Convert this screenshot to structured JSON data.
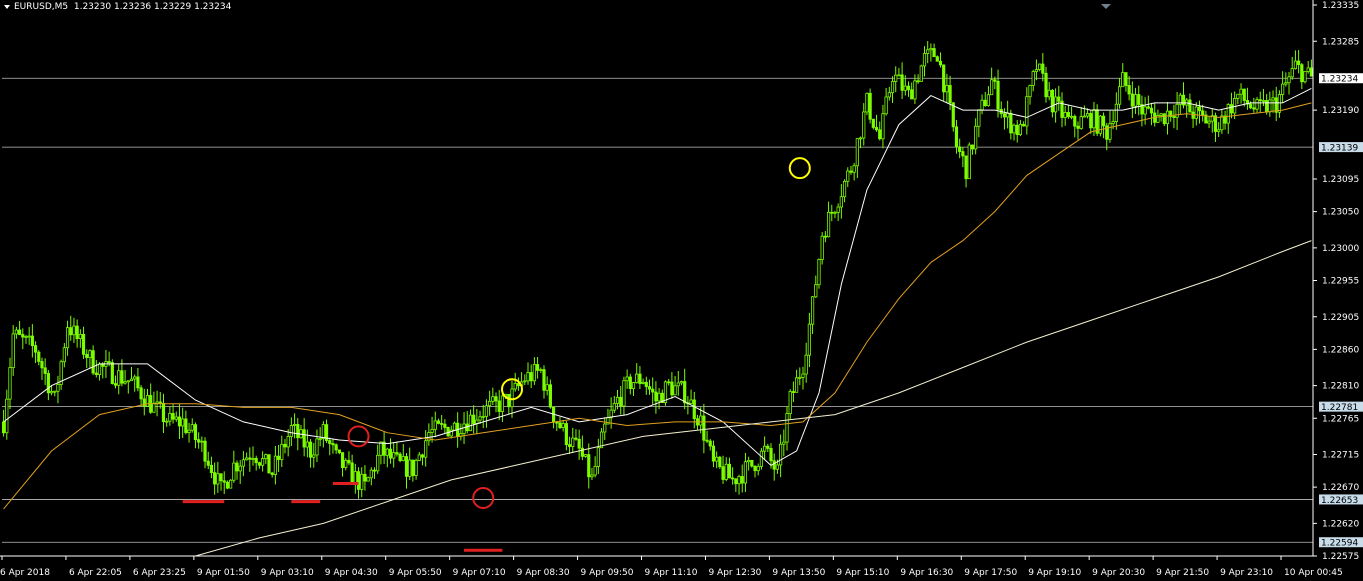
{
  "header": {
    "symbol": "EURUSD,M5",
    "ohlc": "1.23230 1.23236 1.23229 1.23234"
  },
  "colors": {
    "background": "#000000",
    "candles": "#7CFC00",
    "fast_ma": "#ffffff",
    "mid_ma": "#e0a020",
    "slow_ma": "#f5f0d0",
    "hlines": "#c0c0c0",
    "price_tag_current": "#ffffff",
    "price_tag_level": "#c9dcea",
    "markers_red": "#e02020",
    "markers_yellow": "#ffff00",
    "axis_text": "#ffffff"
  },
  "chart_data": {
    "type": "candlestick",
    "symbol": "EURUSD",
    "timeframe": "M5",
    "ylim": [
      1.22575,
      1.23335
    ],
    "y_ticks": [
      "1.23335",
      "1.23285",
      "1.23234",
      "1.23190",
      "1.23139",
      "1.23095",
      "1.23050",
      "1.23000",
      "1.22955",
      "1.22905",
      "1.22860",
      "1.22810",
      "1.22781",
      "1.22765",
      "1.22715",
      "1.22670",
      "1.22653",
      "1.22620",
      "1.22594",
      "1.22575"
    ],
    "x_ticks": [
      "6 Apr 2018",
      "6 Apr 22:05",
      "6 Apr 23:25",
      "9 Apr 01:50",
      "9 Apr 03:10",
      "9 Apr 04:30",
      "9 Apr 05:50",
      "9 Apr 07:10",
      "9 Apr 08:30",
      "9 Apr 09:50",
      "9 Apr 11:10",
      "9 Apr 12:30",
      "9 Apr 13:50",
      "9 Apr 15:10",
      "9 Apr 16:30",
      "9 Apr 17:50",
      "9 Apr 19:10",
      "9 Apr 20:30",
      "9 Apr 21:50",
      "9 Apr 23:10",
      "10 Apr 00:45"
    ],
    "x_tick_bar_index": [
      0,
      20,
      40,
      60,
      80,
      100,
      120,
      140,
      160,
      180,
      200,
      220,
      240,
      260,
      280,
      300,
      320,
      340,
      360,
      380,
      400
    ],
    "bar_count": 410,
    "price_path": [
      [
        0,
        1.2276
      ],
      [
        3,
        1.2288
      ],
      [
        10,
        1.2286
      ],
      [
        16,
        1.2279
      ],
      [
        20,
        1.22895
      ],
      [
        28,
        1.2284
      ],
      [
        40,
        1.22815
      ],
      [
        47,
        1.2278
      ],
      [
        52,
        1.2276
      ],
      [
        56,
        1.2276
      ],
      [
        63,
        1.2272
      ],
      [
        68,
        1.22665
      ],
      [
        72,
        1.227
      ],
      [
        78,
        1.2272
      ],
      [
        84,
        1.2269
      ],
      [
        90,
        1.2275
      ],
      [
        96,
        1.2272
      ],
      [
        100,
        1.22745
      ],
      [
        104,
        1.2271
      ],
      [
        108,
        1.2269
      ],
      [
        113,
        1.2267
      ],
      [
        118,
        1.2272
      ],
      [
        124,
        1.227
      ],
      [
        128,
        1.22695
      ],
      [
        133,
        1.22745
      ],
      [
        137,
        1.2275
      ],
      [
        142,
        1.22755
      ],
      [
        150,
        1.22775
      ],
      [
        158,
        1.2279
      ],
      [
        163,
        1.2282
      ],
      [
        168,
        1.2283
      ],
      [
        172,
        1.2277
      ],
      [
        176,
        1.2274
      ],
      [
        180,
        1.2272
      ],
      [
        184,
        1.2268
      ],
      [
        188,
        1.2275
      ],
      [
        192,
        1.2279
      ],
      [
        196,
        1.22815
      ],
      [
        200,
        1.2282
      ],
      [
        204,
        1.2279
      ],
      [
        208,
        1.2281
      ],
      [
        213,
        1.228
      ],
      [
        218,
        1.2276
      ],
      [
        222,
        1.227
      ],
      [
        228,
        1.2268
      ],
      [
        234,
        1.227
      ],
      [
        238,
        1.2272
      ],
      [
        242,
        1.2269
      ],
      [
        246,
        1.2279
      ],
      [
        250,
        1.2284
      ],
      [
        253,
        1.2292
      ],
      [
        256,
        1.2302
      ],
      [
        260,
        1.2306
      ],
      [
        265,
        1.2311
      ],
      [
        270,
        1.232
      ],
      [
        274,
        1.2315
      ],
      [
        278,
        1.2324
      ],
      [
        283,
        1.2321
      ],
      [
        288,
        1.2326
      ],
      [
        292,
        1.2327
      ],
      [
        295,
        1.2321
      ],
      [
        298,
        1.2314
      ],
      [
        301,
        1.2311
      ],
      [
        305,
        1.2318
      ],
      [
        309,
        1.2323
      ],
      [
        313,
        1.2318
      ],
      [
        318,
        1.2316
      ],
      [
        323,
        1.2325
      ],
      [
        328,
        1.232
      ],
      [
        334,
        1.2317
      ],
      [
        340,
        1.2318
      ],
      [
        345,
        1.2316
      ],
      [
        350,
        1.2323
      ],
      [
        356,
        1.2319
      ],
      [
        362,
        1.2318
      ],
      [
        368,
        1.232
      ],
      [
        374,
        1.2318
      ],
      [
        380,
        1.2317
      ],
      [
        386,
        1.2321
      ],
      [
        392,
        1.2319
      ],
      [
        398,
        1.232
      ],
      [
        404,
        1.2325
      ],
      [
        409,
        1.23234
      ]
    ],
    "moving_averages": [
      {
        "key": "fast_ma",
        "points": [
          [
            0,
            1.2276
          ],
          [
            15,
            1.2281
          ],
          [
            30,
            1.2284
          ],
          [
            45,
            1.2284
          ],
          [
            60,
            1.2279
          ],
          [
            75,
            1.2276
          ],
          [
            90,
            1.22745
          ],
          [
            105,
            1.22735
          ],
          [
            120,
            1.2273
          ],
          [
            135,
            1.2274
          ],
          [
            150,
            1.2276
          ],
          [
            165,
            1.2278
          ],
          [
            180,
            1.2276
          ],
          [
            195,
            1.2277
          ],
          [
            210,
            1.22795
          ],
          [
            225,
            1.2276
          ],
          [
            240,
            1.227
          ],
          [
            248,
            1.2272
          ],
          [
            255,
            1.228
          ],
          [
            262,
            1.2295
          ],
          [
            270,
            1.2308
          ],
          [
            280,
            1.2317
          ],
          [
            290,
            1.2321
          ],
          [
            300,
            1.2319
          ],
          [
            310,
            1.2319
          ],
          [
            320,
            1.2318
          ],
          [
            330,
            1.232
          ],
          [
            340,
            1.2319
          ],
          [
            350,
            1.2319
          ],
          [
            360,
            1.232
          ],
          [
            370,
            1.232
          ],
          [
            380,
            1.2319
          ],
          [
            390,
            1.232
          ],
          [
            400,
            1.232
          ],
          [
            409,
            1.2322
          ]
        ]
      },
      {
        "key": "mid_ma",
        "points": [
          [
            0,
            1.2264
          ],
          [
            15,
            1.2272
          ],
          [
            30,
            1.2277
          ],
          [
            45,
            1.22785
          ],
          [
            60,
            1.22785
          ],
          [
            75,
            1.2278
          ],
          [
            90,
            1.2278
          ],
          [
            105,
            1.2277
          ],
          [
            120,
            1.22745
          ],
          [
            135,
            1.22735
          ],
          [
            150,
            1.22745
          ],
          [
            165,
            1.22755
          ],
          [
            180,
            1.22765
          ],
          [
            195,
            1.22755
          ],
          [
            210,
            1.2276
          ],
          [
            225,
            1.2276
          ],
          [
            240,
            1.22755
          ],
          [
            250,
            1.2276
          ],
          [
            260,
            1.228
          ],
          [
            270,
            1.2287
          ],
          [
            280,
            1.2293
          ],
          [
            290,
            1.2298
          ],
          [
            300,
            1.2301
          ],
          [
            310,
            1.2305
          ],
          [
            320,
            1.231
          ],
          [
            330,
            1.2313
          ],
          [
            340,
            1.2316
          ],
          [
            350,
            1.2317
          ],
          [
            360,
            1.2318
          ],
          [
            370,
            1.23185
          ],
          [
            380,
            1.2318
          ],
          [
            390,
            1.23185
          ],
          [
            400,
            1.2319
          ],
          [
            409,
            1.232
          ]
        ]
      },
      {
        "key": "slow_ma",
        "points": [
          [
            60,
            1.22575
          ],
          [
            80,
            1.226
          ],
          [
            100,
            1.2262
          ],
          [
            120,
            1.2265
          ],
          [
            140,
            1.2268
          ],
          [
            160,
            1.227
          ],
          [
            180,
            1.2272
          ],
          [
            200,
            1.2274
          ],
          [
            220,
            1.2275
          ],
          [
            240,
            1.2276
          ],
          [
            260,
            1.2277
          ],
          [
            280,
            1.228
          ],
          [
            300,
            1.22835
          ],
          [
            320,
            1.2287
          ],
          [
            340,
            1.229
          ],
          [
            360,
            1.2293
          ],
          [
            380,
            1.2296
          ],
          [
            400,
            1.22995
          ],
          [
            409,
            1.2301
          ]
        ]
      }
    ],
    "horizontal_lines": [
      1.23234,
      1.23139,
      1.22781,
      1.22653,
      1.22594
    ],
    "price_tags": [
      {
        "value": "1.23234",
        "style": "price_tag_current"
      },
      {
        "value": "1.23139",
        "style": "price_tag_level"
      },
      {
        "value": "1.22781",
        "style": "price_tag_level"
      },
      {
        "value": "1.22653",
        "style": "price_tag_level"
      },
      {
        "value": "1.22594",
        "style": "price_tag_level"
      }
    ],
    "annotations": [
      {
        "kind": "red-line",
        "bar_from": 56,
        "bar_to": 69,
        "price": 1.2265
      },
      {
        "kind": "red-line",
        "bar_from": 90,
        "bar_to": 99,
        "price": 1.2265
      },
      {
        "kind": "red-line",
        "bar_from": 103,
        "bar_to": 111,
        "price": 1.22675
      },
      {
        "kind": "red-line",
        "bar_from": 144,
        "bar_to": 156,
        "price": 1.22583
      },
      {
        "kind": "red-circle",
        "bar": 111,
        "price": 1.2274
      },
      {
        "kind": "red-circle",
        "bar": 150,
        "price": 1.22655
      },
      {
        "kind": "yellow-circle",
        "bar": 159,
        "price": 1.22805
      },
      {
        "kind": "yellow-circle",
        "bar": 249,
        "price": 1.2311
      }
    ]
  }
}
